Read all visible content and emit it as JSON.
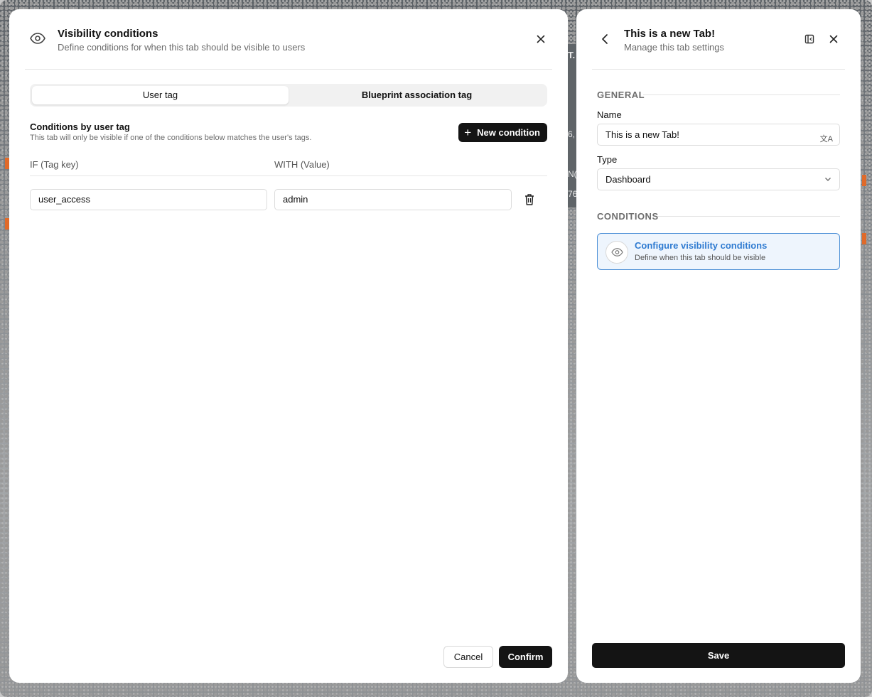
{
  "backdrop": {
    "peek_texts": [
      "T.",
      "6,",
      "N(",
      "76"
    ]
  },
  "visibility_modal": {
    "title": "Visibility conditions",
    "subtitle": "Define conditions for when this tab should be visible to users",
    "tabs": [
      {
        "label": "User tag",
        "active": true
      },
      {
        "label": "Blueprint association tag",
        "active": false
      }
    ],
    "section_title": "Conditions by user tag",
    "section_description": "This tab will only be visible if one of the conditions below matches the user's tags.",
    "new_condition_label": "New condition",
    "columns": {
      "key": "IF (Tag key)",
      "value": "WITH (Value)"
    },
    "conditions": [
      {
        "key": "user_access",
        "value": "admin"
      }
    ],
    "cancel_label": "Cancel",
    "confirm_label": "Confirm"
  },
  "tab_settings": {
    "title": "This is a new Tab!",
    "subtitle": "Manage this tab settings",
    "general_label": "GENERAL",
    "name_label": "Name",
    "name_value": "This is a new Tab!",
    "type_label": "Type",
    "type_value": "Dashboard",
    "conditions_label": "CONDITIONS",
    "configure_title": "Configure visibility conditions",
    "configure_desc": "Define when this tab should be visible",
    "save_label": "Save"
  },
  "colors": {
    "primary_button": "#141414",
    "accent_blue": "#2f7bd1",
    "accent_bg": "#eef5fd"
  }
}
